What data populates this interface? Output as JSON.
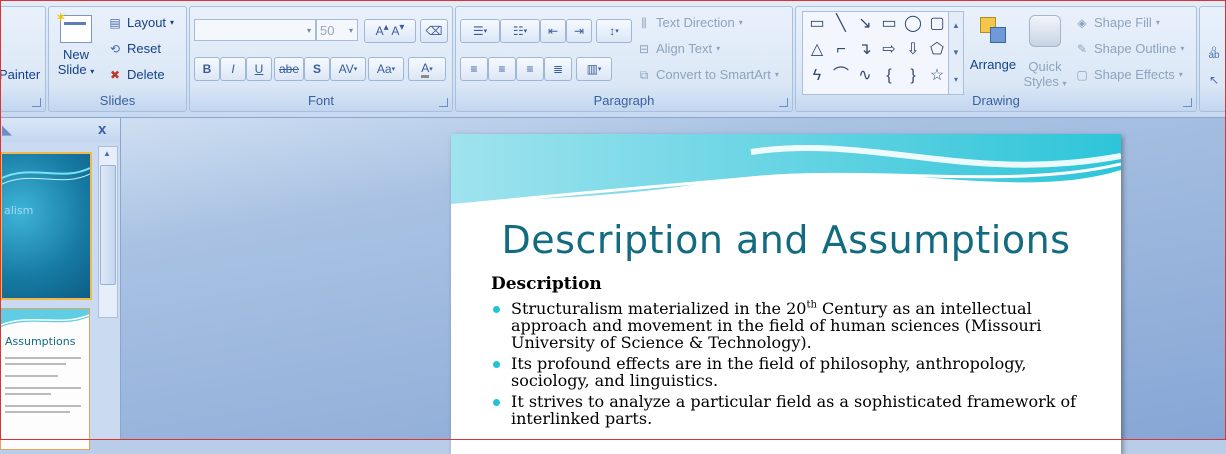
{
  "ribbon": {
    "clipboard": {
      "format_painter": "Painter"
    },
    "slides": {
      "label": "Slides",
      "new_slide_line1": "New",
      "new_slide_line2": "Slide",
      "layout": "Layout",
      "reset": "Reset",
      "delete": "Delete"
    },
    "font": {
      "label": "Font",
      "font_name": "",
      "font_size": "50",
      "bold": "B",
      "italic": "I",
      "underline": "U",
      "strike": "abe",
      "shadow": "S",
      "spacing": "AV",
      "case": "Aa",
      "color": "A"
    },
    "paragraph": {
      "label": "Paragraph",
      "text_direction": "Text Direction",
      "align_text": "Align Text",
      "convert_smartart": "Convert to SmartArt"
    },
    "drawing": {
      "label": "Drawing",
      "arrange": "Arrange",
      "quick_styles_line1": "Quick",
      "quick_styles_line2": "Styles",
      "shape_fill": "Shape Fill",
      "shape_outline": "Shape Outline",
      "shape_effects": "Shape Effects"
    }
  },
  "panel": {
    "close": "x",
    "thumb1_text": "alism",
    "thumb2_title": "Assumptions"
  },
  "slide": {
    "title": "Description and Assumptions",
    "heading": "Description",
    "bullets": [
      {
        "pre": "Structuralism materialized in the 20",
        "sup": "th",
        "post": " Century as an intellectual approach and movement in the field of human sciences (Missouri University of Science & Technology)."
      },
      {
        "pre": "Its profound effects are in the field of philosophy, anthropology, sociology, and linguistics.",
        "sup": "",
        "post": ""
      },
      {
        "pre": "It strives to analyze a particular field  as a sophisticated framework of interlinked parts.",
        "sup": "",
        "post": ""
      }
    ]
  },
  "colors": {
    "title": "#136b82",
    "bullet": "#22c4d3",
    "ribbon": "#dbe7f6"
  }
}
